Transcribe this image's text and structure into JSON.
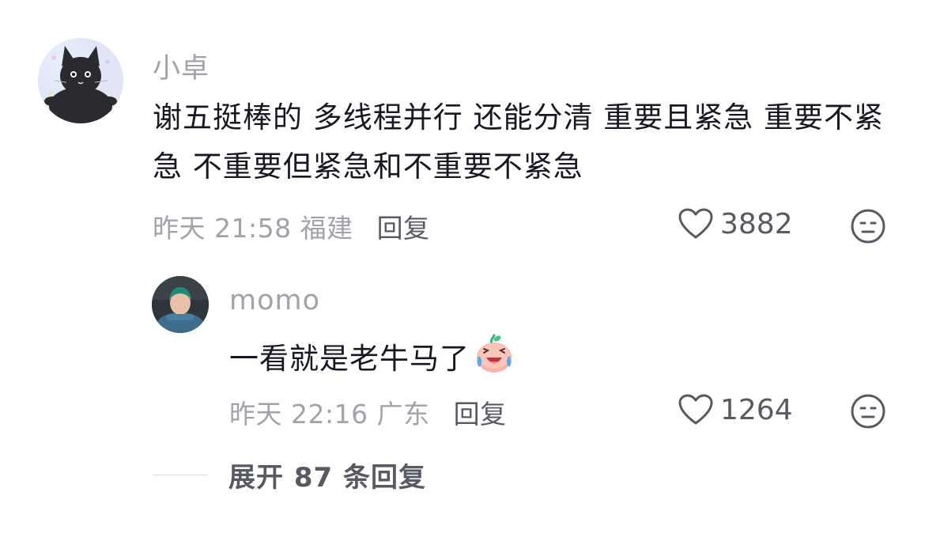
{
  "comment": {
    "username": "小卓",
    "text": "谢五挺棒的 多线程并行 还能分清 重要且紧急 重要不紧急 不重要但紧急和不重要不紧急",
    "meta": "昨天 21:58 福建",
    "reply_label": "回复",
    "likes": "3882"
  },
  "reply": {
    "username": "momo",
    "text": "一看就是老牛马了",
    "emoji": "crying-laughing-face",
    "meta": "昨天 22:16 广东",
    "reply_label": "回复",
    "likes": "1264"
  },
  "expand": {
    "label": "展开 87 条回复"
  },
  "colors": {
    "primary_text": "#161823",
    "secondary_text": "#a0a3aa",
    "action_text": "#585a63"
  }
}
